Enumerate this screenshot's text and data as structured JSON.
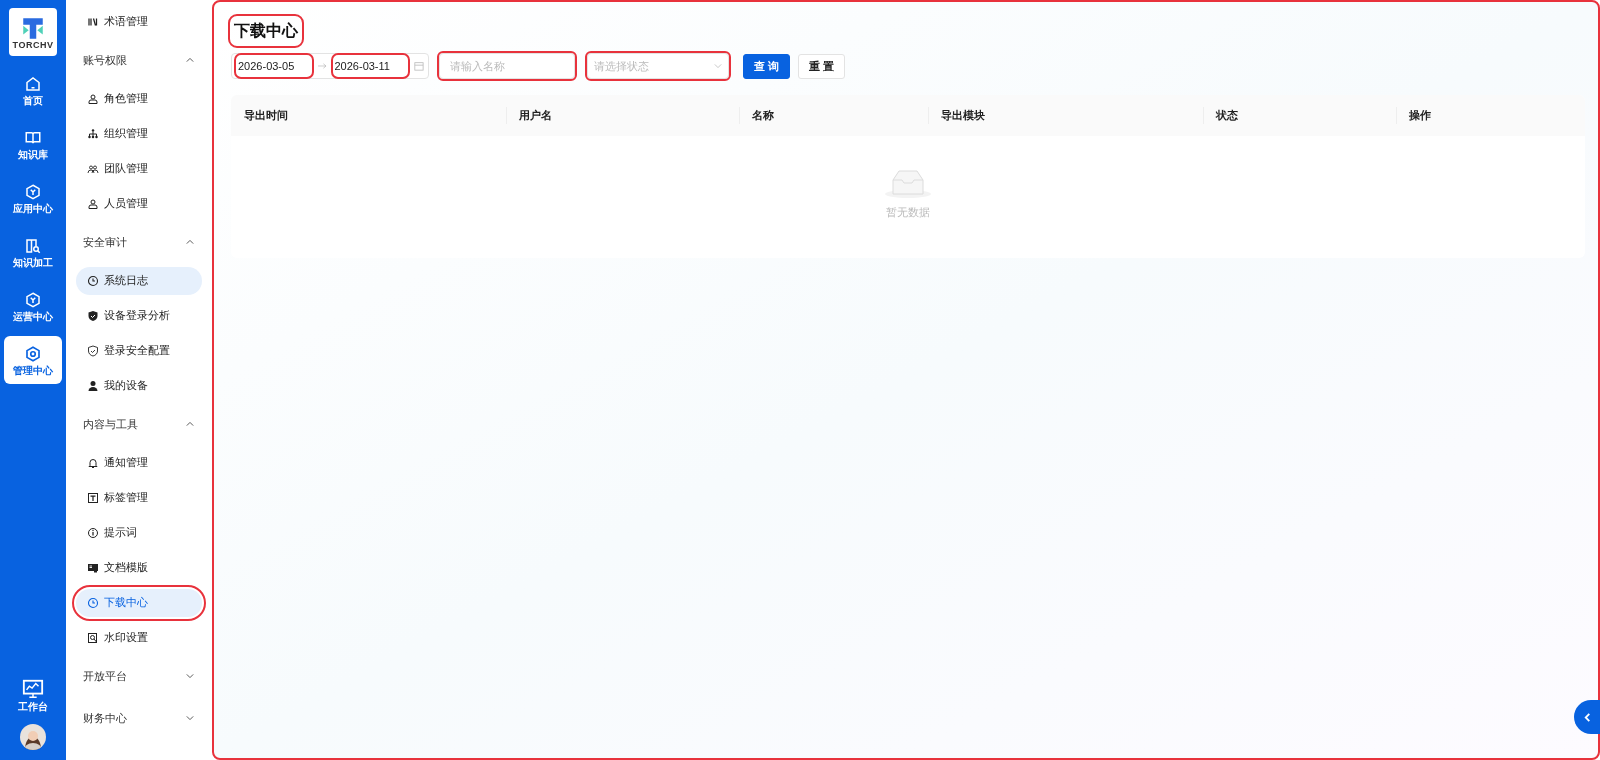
{
  "brand": {
    "logo_text": "TORCHV"
  },
  "rail": [
    {
      "label": "首页",
      "selected": false
    },
    {
      "label": "知识库",
      "selected": false
    },
    {
      "label": "应用中心",
      "selected": false
    },
    {
      "label": "知识加工",
      "selected": false
    },
    {
      "label": "运营中心",
      "selected": false
    },
    {
      "label": "管理中心",
      "selected": true
    }
  ],
  "rail_bottom": {
    "label": "工作台"
  },
  "submenu": [
    {
      "kind": "item",
      "label": "术语管理",
      "selected": false,
      "highlighted": false,
      "annotated": false
    },
    {
      "kind": "group",
      "label": "账号权限",
      "expanded": true
    },
    {
      "kind": "item",
      "label": "角色管理",
      "selected": false,
      "highlighted": false,
      "annotated": false
    },
    {
      "kind": "item",
      "label": "组织管理",
      "selected": false,
      "highlighted": false,
      "annotated": false
    },
    {
      "kind": "item",
      "label": "团队管理",
      "selected": false,
      "highlighted": false,
      "annotated": false
    },
    {
      "kind": "item",
      "label": "人员管理",
      "selected": false,
      "highlighted": false,
      "annotated": false
    },
    {
      "kind": "group",
      "label": "安全审计",
      "expanded": true
    },
    {
      "kind": "item",
      "label": "系统日志",
      "selected": false,
      "highlighted": true,
      "annotated": false
    },
    {
      "kind": "item",
      "label": "设备登录分析",
      "selected": false,
      "highlighted": false,
      "annotated": false
    },
    {
      "kind": "item",
      "label": "登录安全配置",
      "selected": false,
      "highlighted": false,
      "annotated": false
    },
    {
      "kind": "item",
      "label": "我的设备",
      "selected": false,
      "highlighted": false,
      "annotated": false
    },
    {
      "kind": "group",
      "label": "内容与工具",
      "expanded": true
    },
    {
      "kind": "item",
      "label": "通知管理",
      "selected": false,
      "highlighted": false,
      "annotated": false
    },
    {
      "kind": "item",
      "label": "标签管理",
      "selected": false,
      "highlighted": false,
      "annotated": false
    },
    {
      "kind": "item",
      "label": "提示词",
      "selected": false,
      "highlighted": false,
      "annotated": false
    },
    {
      "kind": "item",
      "label": "文档模版",
      "selected": false,
      "highlighted": false,
      "annotated": false
    },
    {
      "kind": "item",
      "label": "下载中心",
      "selected": true,
      "highlighted": true,
      "annotated": true
    },
    {
      "kind": "item",
      "label": "水印设置",
      "selected": false,
      "highlighted": false,
      "annotated": false
    },
    {
      "kind": "group",
      "label": "开放平台",
      "expanded": false
    },
    {
      "kind": "group",
      "label": "财务中心",
      "expanded": false
    }
  ],
  "main": {
    "annotated": true,
    "title": "下载中心",
    "title_annotated": true
  },
  "filters": {
    "start_date": "2026-03-05",
    "end_date": "2026-03-11",
    "dates_annotated": true,
    "name": {
      "placeholder": "请输入名称",
      "annotated": true
    },
    "status": {
      "placeholder": "请选择状态",
      "annotated": true
    },
    "buttons": [
      {
        "label": "查 询",
        "kind": "primary"
      },
      {
        "label": "重 置",
        "kind": "default"
      }
    ]
  },
  "table": {
    "columns": [
      "导出时间",
      "用户名",
      "名称",
      "导出模块",
      "状态",
      "操作"
    ],
    "empty_text": "暂无数据"
  }
}
